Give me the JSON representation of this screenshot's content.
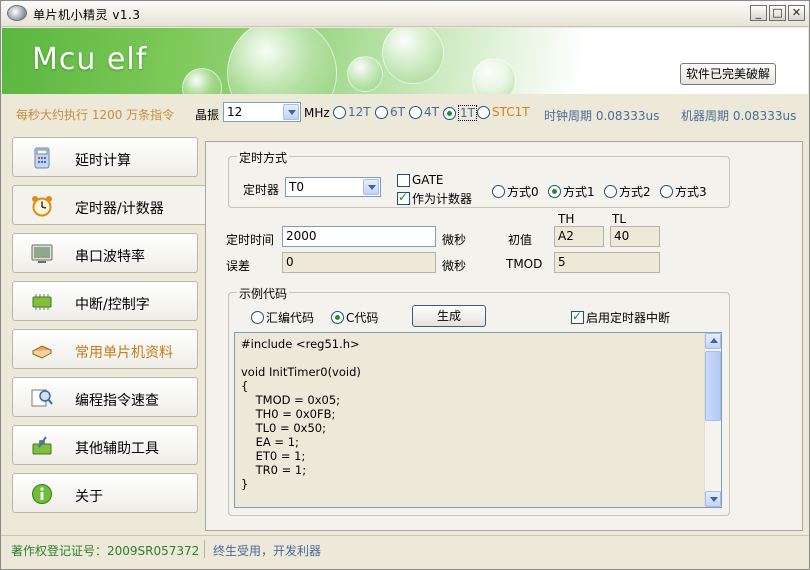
{
  "window": {
    "title": "单片机小精灵  v1.3"
  },
  "banner": {
    "logo": "Mcu elf",
    "crack_button": "软件已完美破解"
  },
  "info": {
    "exec_text": "每秒大约执行 1200 万条指令",
    "xtal_label": "晶振",
    "xtal_value": "12",
    "mhz_label": "MHz",
    "cycle_options": [
      {
        "label": "12T",
        "selected": false
      },
      {
        "label": "6T",
        "selected": false
      },
      {
        "label": "4T",
        "selected": false
      },
      {
        "label": "1T",
        "selected": true
      },
      {
        "label": "STC1T",
        "selected": false
      }
    ],
    "clock_period_label": "时钟周期",
    "clock_period_value": "0.08333us",
    "machine_period_label": "机器周期",
    "machine_period_value": "0.08333us"
  },
  "sidebar": {
    "items": [
      {
        "label": "延时计算",
        "active": false
      },
      {
        "label": "定时器/计数器",
        "active": true
      },
      {
        "label": "串口波特率",
        "active": false
      },
      {
        "label": "中断/控制字",
        "active": false
      },
      {
        "label": "常用单片机资料",
        "active": false
      },
      {
        "label": "编程指令速查",
        "active": false
      },
      {
        "label": "其他辅助工具",
        "active": false
      },
      {
        "label": "关于",
        "active": false
      }
    ]
  },
  "timer_mode": {
    "group_title": "定时方式",
    "timer_label": "定时器",
    "timer_value": "T0",
    "gate_label": "GATE",
    "gate_checked": false,
    "counter_label": "作为计数器",
    "counter_checked": true,
    "modes": [
      {
        "label": "方式0",
        "selected": false
      },
      {
        "label": "方式1",
        "selected": true
      },
      {
        "label": "方式2",
        "selected": false
      },
      {
        "label": "方式3",
        "selected": false
      }
    ]
  },
  "timing": {
    "time_label": "定时时间",
    "time_value": "2000",
    "time_unit": "微秒",
    "error_label": "误差",
    "error_value": "0",
    "error_unit": "微秒",
    "init_label": "初值",
    "th_label": "TH",
    "th_value": "A2",
    "tl_label": "TL",
    "tl_value": "40",
    "tmod_label": "TMOD",
    "tmod_value": "5"
  },
  "example": {
    "group_title": "示例代码",
    "asm_label": "汇编代码",
    "asm_selected": false,
    "c_label": "C代码",
    "c_selected": true,
    "generate_button": "生成",
    "interrupt_label": "启用定时器中断",
    "interrupt_checked": true,
    "code_lines": [
      "#include <reg51.h>",
      "",
      "void InitTimer0(void)",
      "{",
      "    TMOD = 0x05;",
      "    TH0 = 0x0FB;",
      "    TL0 = 0x50;",
      "    EA = 1;",
      "    ET0 = 1;",
      "    TR0 = 1;",
      "}"
    ]
  },
  "status": {
    "copyright": "著作权登记证号：2009SR057372",
    "slogan": "终生受用，开发利器"
  },
  "colors": {
    "accent_green": "#2f7d2f",
    "exec_orange": "#c98d3c",
    "info_blue": "#4a6a99",
    "highlight_orange": "#c97a1a"
  }
}
